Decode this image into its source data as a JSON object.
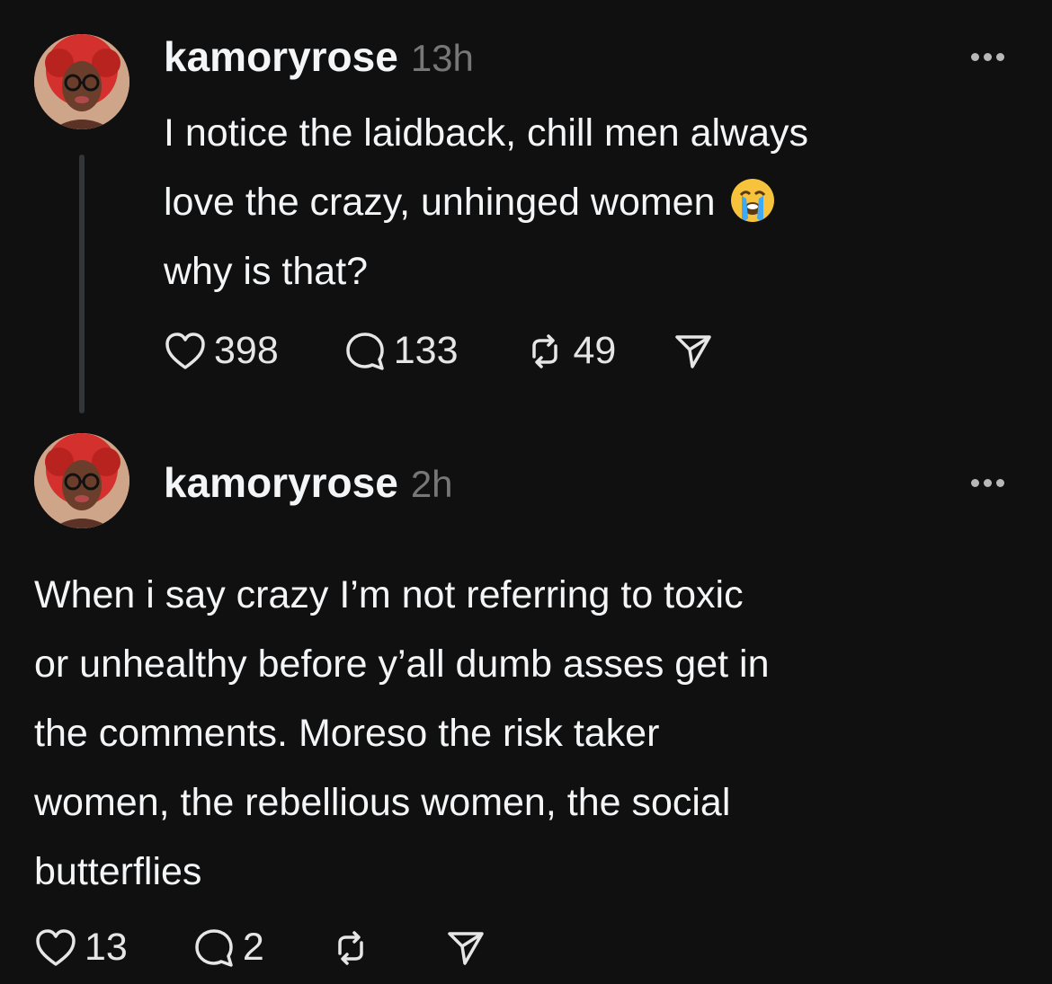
{
  "posts": [
    {
      "username": "kamoryrose",
      "time": "13h",
      "text_lines": [
        "I notice the laidback, chill men always",
        "love the crazy, unhinged women",
        "why is that?"
      ],
      "emoji_icon": "loudly-crying-face-icon",
      "likes": "398",
      "replies": "133",
      "reposts": "49"
    },
    {
      "username": "kamoryrose",
      "time": "2h",
      "text_lines": [
        "When i say crazy I’m not referring to toxic",
        "or unhealthy before y’all dumb asses get in",
        "the comments. Moreso the risk taker",
        "women, the rebellious women, the social",
        "butterflies"
      ],
      "likes": "13",
      "replies": "2"
    }
  ],
  "icons": [
    "heart-icon",
    "comment-icon",
    "repost-icon",
    "share-icon",
    "more-options-icon"
  ],
  "colors": {
    "background": "#101010",
    "text": "#f3f5f7",
    "muted": "#777777",
    "thread_line": "#333638"
  }
}
